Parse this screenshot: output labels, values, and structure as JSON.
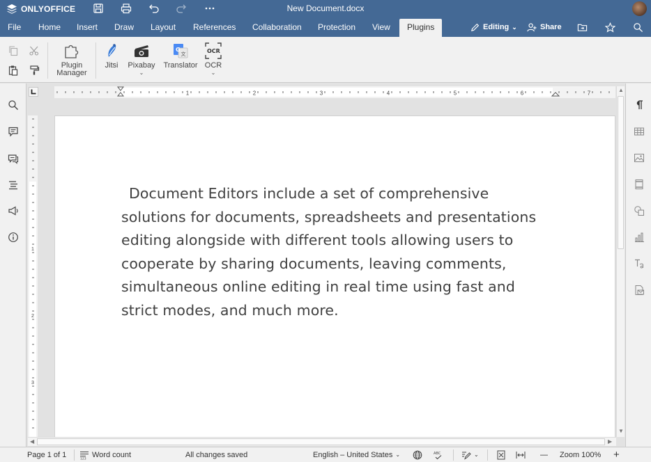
{
  "app": {
    "name": "ONLYOFFICE",
    "document_title": "New Document.docx"
  },
  "menu": {
    "tabs": [
      {
        "label": "File"
      },
      {
        "label": "Home"
      },
      {
        "label": "Insert"
      },
      {
        "label": "Draw"
      },
      {
        "label": "Layout"
      },
      {
        "label": "References"
      },
      {
        "label": "Collaboration"
      },
      {
        "label": "Protection"
      },
      {
        "label": "View"
      },
      {
        "label": "Plugins"
      }
    ],
    "active_tab": "Plugins",
    "mode_label": "Editing",
    "share_label": "Share"
  },
  "toolbar": {
    "plugin_manager_label_1": "Plugin",
    "plugin_manager_label_2": "Manager",
    "plugins": [
      {
        "label": "Jitsi",
        "icon": "jitsi-icon",
        "has_dropdown": false
      },
      {
        "label": "Pixabay",
        "icon": "camera-icon",
        "has_dropdown": true
      },
      {
        "label": "Translator",
        "icon": "google-translate-icon",
        "has_dropdown": false
      },
      {
        "label": "OCR",
        "icon": "ocr-icon",
        "has_dropdown": true
      }
    ],
    "ocr_icon_text": "OCR",
    "caret": "⌄"
  },
  "document": {
    "text": "Document Editors include a set of comprehensive solutions for documents, spreadsheets and presentations editing alongside with different tools allowing users to cooperate by sharing documents, leaving comments, simultaneous online editing in real time using fast and strict modes, and much more."
  },
  "ruler": {
    "h_labels": [
      "1",
      "2",
      "3",
      "4",
      "5",
      "6",
      "7"
    ],
    "v_labels": [
      "1",
      "2",
      "3"
    ]
  },
  "status": {
    "page_info": "Page 1 of 1",
    "word_count": "Word count",
    "save_state": "All changes saved",
    "language": "English – United States",
    "zoom": "Zoom 100%",
    "zoom_out": "—",
    "zoom_in": "+"
  },
  "colors": {
    "header": "#446995",
    "toolbar_bg": "#f1f1f1",
    "workspace": "#e2e2e2"
  }
}
